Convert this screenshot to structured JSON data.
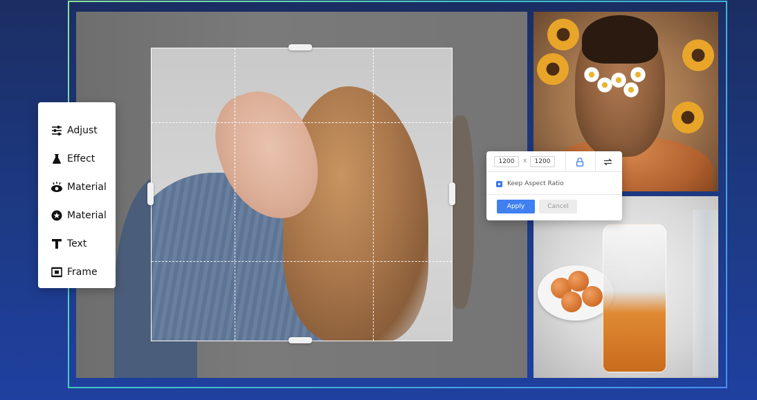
{
  "tool_menu": {
    "items": [
      {
        "icon": "sliders-icon",
        "label": "Adjust"
      },
      {
        "icon": "flask-icon",
        "label": "Effect"
      },
      {
        "icon": "eye-icon",
        "label": "Material"
      },
      {
        "icon": "star-badge-icon",
        "label": "Material"
      },
      {
        "icon": "text-t-icon",
        "label": "Text"
      },
      {
        "icon": "frame-icon",
        "label": "Frame"
      }
    ]
  },
  "resize_dialog": {
    "width_value": "1200",
    "separator": "x",
    "height_value": "1200",
    "lock_icon": "lock-icon",
    "swap_icon": "swap-arrows-icon",
    "keep_aspect_ratio_label": "Keep Aspect Ratio",
    "keep_aspect_ratio_checked": true,
    "apply_label": "Apply",
    "cancel_label": "Cancel"
  },
  "colors": {
    "background": "#1d3a85",
    "accent_blue": "#3f7ff0",
    "frame_gradient_start": "#8fe39a",
    "frame_gradient_end": "#4c8ef0"
  }
}
